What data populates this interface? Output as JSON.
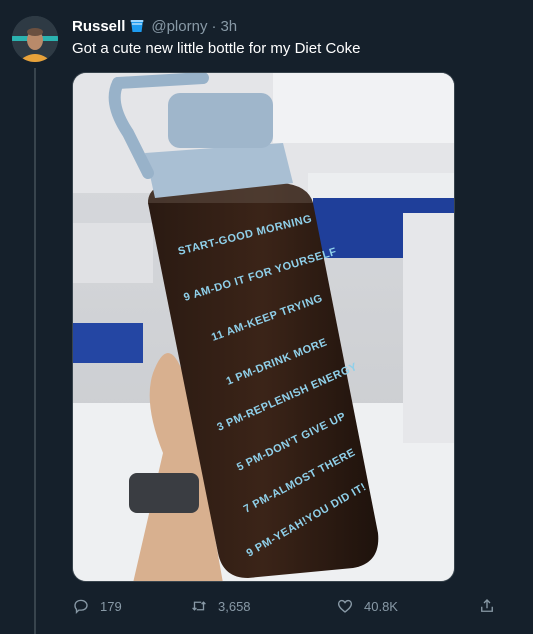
{
  "tweet": {
    "display_name": "Russell",
    "handle": "@plorny",
    "separator": "·",
    "time": "3h",
    "text": "Got a cute new little bottle for my Diet Coke",
    "verified_icon": "cup-badge-icon"
  },
  "media": {
    "bottle_labels": [
      "START-GOOD MORNING",
      "9 AM-DO IT FOR YOURSELF",
      "11 AM-KEEP TRYING",
      "1 PM-DRINK MORE",
      "3 PM-REPLENISH ENERGY",
      "5 PM-DON'T GIVE UP",
      "7 PM-ALMOST THERE",
      "9 PM-YEAH!YOU DID IT!"
    ]
  },
  "actions": {
    "replies": "179",
    "retweets": "3,658",
    "likes": "40.8K"
  },
  "colors": {
    "background": "#15202b",
    "secondary_text": "#8899a6",
    "divider": "#38444d",
    "bottle_text": "#8fd0ea"
  }
}
